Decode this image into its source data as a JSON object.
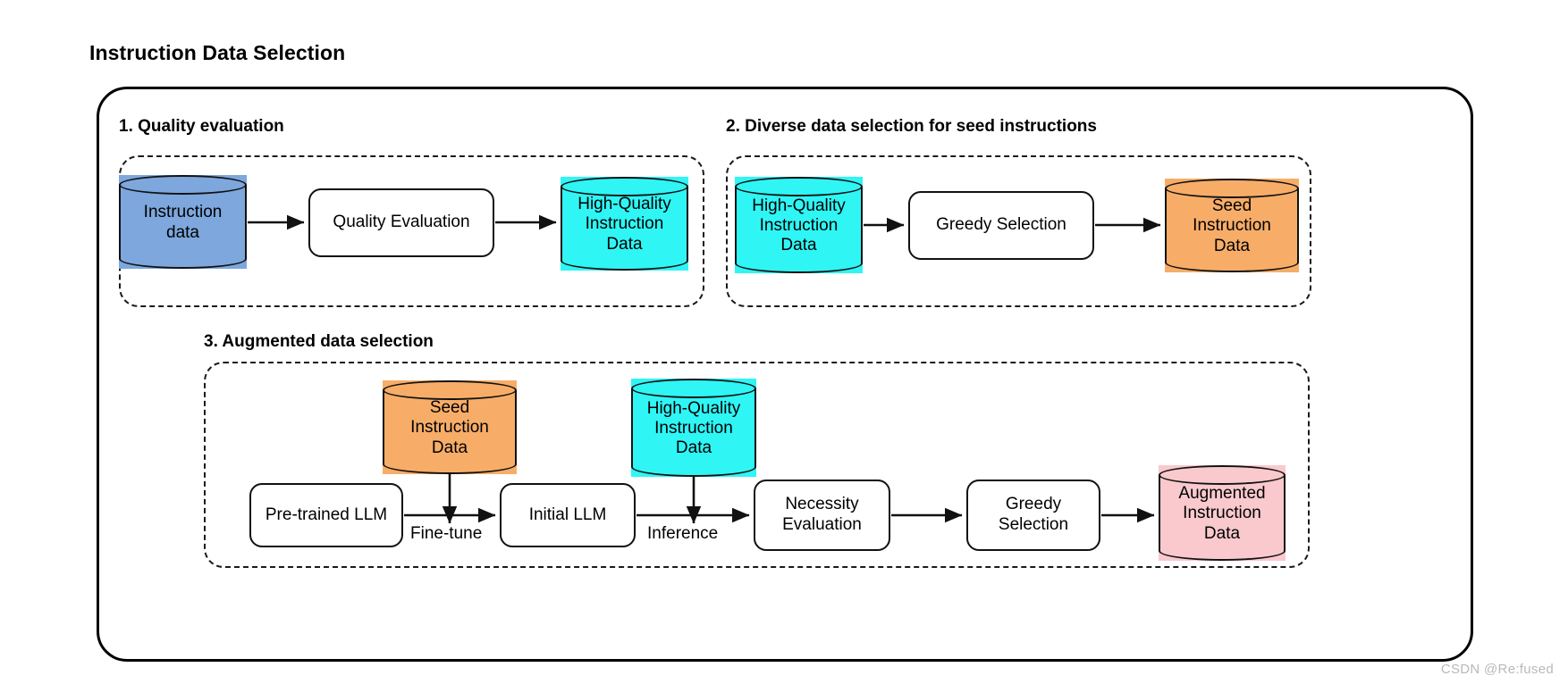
{
  "page": {
    "title": "Instruction Data Selection",
    "watermark": "CSDN @Re:fused",
    "colors": {
      "blue_cylinder": "#7da7dd",
      "cyan_cylinder": "#2ff5f5",
      "orange_cylinder": "#f7ad68",
      "pink_cylinder": "#f9c9cd",
      "box_fill": "#ffffff",
      "stroke": "#111111",
      "watermark_text": "#b9b9b9"
    }
  },
  "sections": [
    {
      "id": "quality-evaluation",
      "heading": "1. Quality evaluation",
      "nodes": [
        {
          "type": "cylinder",
          "name": "instruction-data",
          "label": "Instruction\ndata",
          "color": "#7da7dd"
        },
        {
          "type": "box",
          "name": "quality-evaluation",
          "label": "Quality Evaluation"
        },
        {
          "type": "cylinder",
          "name": "high-quality-instruction-data",
          "label": "High-Quality\nInstruction\nData",
          "color": "#2ff5f5"
        }
      ],
      "edges": [
        {
          "from": "instruction-data",
          "to": "quality-evaluation",
          "label": ""
        },
        {
          "from": "quality-evaluation",
          "to": "high-quality-instruction-data",
          "label": ""
        }
      ]
    },
    {
      "id": "diverse-data-selection",
      "heading": "2. Diverse data selection for seed instructions",
      "nodes": [
        {
          "type": "cylinder",
          "name": "high-quality-instruction-data",
          "label": "High-Quality\nInstruction\nData",
          "color": "#2ff5f5"
        },
        {
          "type": "box",
          "name": "greedy-selection",
          "label": "Greedy Selection"
        },
        {
          "type": "cylinder",
          "name": "seed-instruction-data",
          "label": "Seed\nInstruction\nData",
          "color": "#f7ad68"
        }
      ],
      "edges": [
        {
          "from": "high-quality-instruction-data",
          "to": "greedy-selection",
          "label": ""
        },
        {
          "from": "greedy-selection",
          "to": "seed-instruction-data",
          "label": ""
        }
      ]
    },
    {
      "id": "augmented-data-selection",
      "heading": "3. Augmented data selection",
      "nodes": [
        {
          "type": "cylinder",
          "name": "seed-instruction-data",
          "label": "Seed\nInstruction\nData",
          "color": "#f7ad68"
        },
        {
          "type": "cylinder",
          "name": "high-quality-instruction-data",
          "label": "High-Quality\nInstruction\nData",
          "color": "#2ff5f5"
        },
        {
          "type": "box",
          "name": "pre-trained-llm",
          "label": "Pre-trained LLM"
        },
        {
          "type": "box",
          "name": "initial-llm",
          "label": "Initial LLM"
        },
        {
          "type": "box",
          "name": "necessity-evaluation",
          "label": "Necessity\nEvaluation"
        },
        {
          "type": "box",
          "name": "greedy-selection",
          "label": "Greedy\nSelection"
        },
        {
          "type": "cylinder",
          "name": "augmented-instruction-data",
          "label": "Augmented\nInstruction\nData",
          "color": "#f9c9cd"
        }
      ],
      "edges": [
        {
          "from": "pre-trained-llm",
          "to": "initial-llm",
          "label": "Fine-tune"
        },
        {
          "from": "seed-instruction-data",
          "to": "fine-tune-edge",
          "label": ""
        },
        {
          "from": "initial-llm",
          "to": "necessity-evaluation",
          "label": "Inference"
        },
        {
          "from": "high-quality-instruction-data",
          "to": "inference-edge",
          "label": ""
        },
        {
          "from": "necessity-evaluation",
          "to": "greedy-selection",
          "label": ""
        },
        {
          "from": "greedy-selection",
          "to": "augmented-instruction-data",
          "label": ""
        }
      ]
    }
  ]
}
